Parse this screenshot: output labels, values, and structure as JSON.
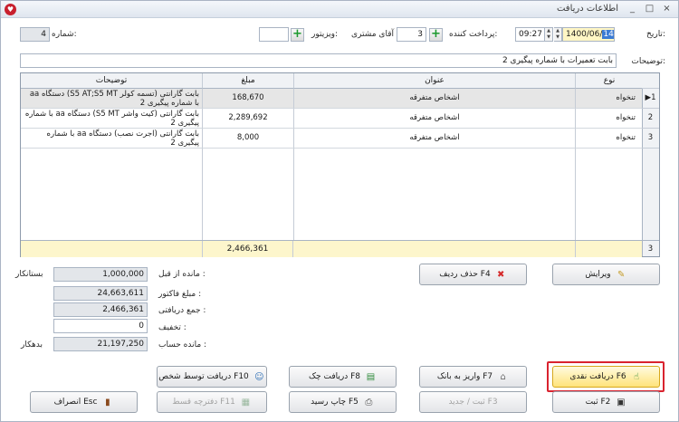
{
  "window": {
    "title": "اطلاعات دریافت",
    "controls": [
      "_",
      "□",
      "×"
    ]
  },
  "header": {
    "date_label": "تاریخ:",
    "date_value": "1400/06/",
    "date_value_selected": "14",
    "time_value": "09:27",
    "payer_label": "پرداخت کننده:",
    "payer_value": "3",
    "customer_name": "آقای مشتری",
    "visitor_label": "ویزیتور:",
    "visitor_value": "",
    "number_label": "شماره:",
    "number_value": "4"
  },
  "description": {
    "label": "توضیحات:",
    "value": "بابت تعمیرات با شماره پیگیری 2"
  },
  "grid": {
    "columns": {
      "type": "نوع",
      "title": "عنوان",
      "amount": "مبلغ",
      "notes": "توضیحات"
    },
    "rows": [
      {
        "index": "1",
        "type": "تنخواه",
        "title": "اشخاص متفرقه",
        "amount": "168,670",
        "notes": "بابت گارانتی (تسمه کولر S5 AT;S5 MT) دستگاه aa با شماره پیگیری 2"
      },
      {
        "index": "2",
        "type": "تنخواه",
        "title": "اشخاص متفرقه",
        "amount": "2,289,692",
        "notes": "بابت گارانتی (کیت واشر S5 MT) دستگاه aa با شماره پیگیری 2"
      },
      {
        "index": "3",
        "type": "تنخواه",
        "title": "اشخاص متفرقه",
        "amount": "8,000",
        "notes": "بابت گارانتی (اجرت نصب) دستگاه aa با شماره پیگیری 2"
      }
    ],
    "total_count": "3",
    "total_amount": "2,466,361"
  },
  "grid_buttons": {
    "edit": "ویرایش",
    "delete_row": "حذف ردیف F4"
  },
  "summary": {
    "prev_balance_label": "مانده از قبل :",
    "prev_balance_value": "1,000,000",
    "prev_balance_status": "بستانکار",
    "invoice_label": "مبلغ فاکتور :",
    "invoice_value": "24,663,611",
    "received_label": "جمع دریافتی :",
    "received_value": "2,466,361",
    "discount_label": "تخفیف :",
    "discount_value": "0",
    "account_label": "مانده حساب :",
    "account_value": "21,197,250",
    "account_status": "بدهکار"
  },
  "actions": {
    "cash": "دریافت نقدی F6",
    "bank": "واریز به بانک F7",
    "cheque": "دریافت چک F8",
    "by_person": "دریافت توسط شخص F10",
    "save": "ثبت F2",
    "save_new": "ثبت / جدید F3",
    "print": "چاپ رسید F5",
    "installment": "دفترچه قسط F11",
    "cancel": "انصراف Esc"
  }
}
